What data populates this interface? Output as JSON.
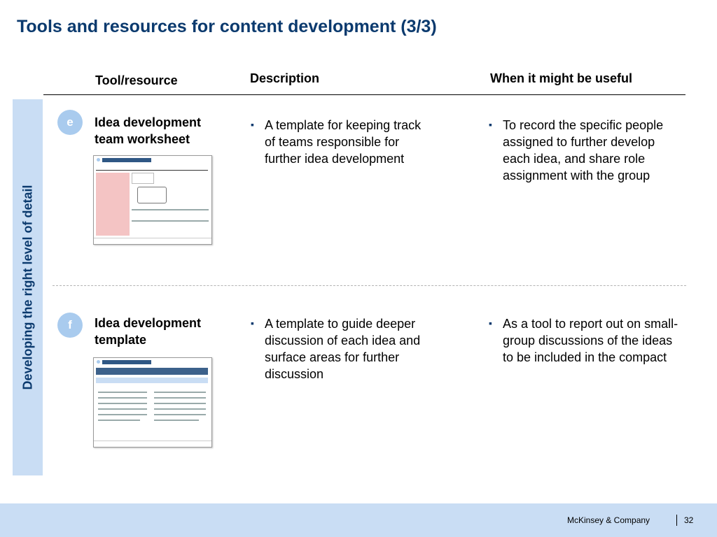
{
  "title": "Tools and resources for content development (3/3)",
  "columns": {
    "tool": "Tool/resource",
    "description": "Description",
    "when": "When it might be useful"
  },
  "side_label": "Developing the right level of detail",
  "rows": [
    {
      "badge": "e",
      "tool_lines": [
        "Idea development",
        "team worksheet"
      ],
      "description_lines": [
        "A template for keeping track",
        "of teams responsible for",
        "further idea development"
      ],
      "when_lines": [
        "To record the specific people",
        "assigned to further develop",
        "each idea, and share role",
        "assignment with the group"
      ]
    },
    {
      "badge": "f",
      "tool_lines": [
        "Idea development",
        "template"
      ],
      "description_lines": [
        "A template to guide deeper",
        "discussion of each idea and",
        "surface areas for further",
        "discussion"
      ],
      "when_lines": [
        "As a tool to report out on small-",
        "group discussions of the ideas",
        "to be included in the compact"
      ]
    }
  ],
  "footer": {
    "company": "McKinsey & Company",
    "page": "32"
  },
  "colors": {
    "title": "#0b3a6e",
    "band": "#c9ddf4",
    "badge": "#a9cbee"
  }
}
